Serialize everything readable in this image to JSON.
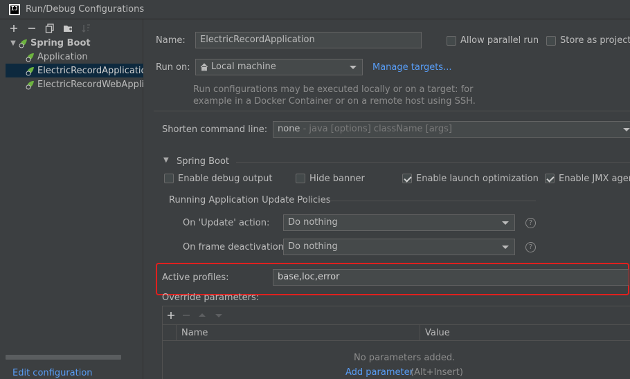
{
  "window": {
    "title": "Run/Debug Configurations",
    "logo_text": "IJ"
  },
  "sidebar": {
    "toolbar": [
      {
        "name": "add-icon",
        "glyph": "+"
      },
      {
        "name": "remove-icon",
        "glyph": "−"
      },
      {
        "name": "copy-icon",
        "glyph": "⧉"
      },
      {
        "name": "folder-icon",
        "glyph": "▣"
      },
      {
        "name": "sort-icon",
        "glyph": "⇅"
      }
    ],
    "group_label": "Spring Boot",
    "items": [
      {
        "label": "Application"
      },
      {
        "label": "ElectricRecordApplication"
      },
      {
        "label": "ElectricRecordWebApplication"
      }
    ],
    "edit_templates_link": "Edit configuration templates..."
  },
  "form": {
    "name_label": "Name:",
    "name_value": "ElectricRecordApplication",
    "allow_parallel_label": "Allow parallel run",
    "store_project_label": "Store as project file",
    "run_on_label": "Run on:",
    "run_on_value": "Local machine",
    "manage_targets": "Manage targets...",
    "run_on_hint_1": "Run configurations may be executed locally or on a target: for",
    "run_on_hint_2": "example in a Docker Container or on a remote host using SSH.",
    "shorten_label": "Shorten command line:",
    "shorten_value": "none",
    "shorten_hint": " - java [options] className [args]",
    "spring_section_label": "Spring Boot",
    "debug_output_label": "Enable debug output",
    "hide_banner_label": "Hide banner",
    "launch_opt_label": "Enable launch optimization",
    "jmx_label": "Enable JMX agent",
    "update_policies_label": "Running Application Update Policies",
    "on_update_label": "On 'Update' action:",
    "on_update_value": "Do nothing",
    "on_frame_label": "On frame deactivation:",
    "on_frame_value": "Do nothing",
    "active_profiles_label": "Active profiles:",
    "active_profiles_value": "base,loc,error",
    "override_label": "Override parameters:",
    "col_name": "Name",
    "col_value": "Value",
    "empty_text": "No parameters added.",
    "add_parameter_link": "Add parameter",
    "add_parameter_shortcut": "(Alt+Insert)"
  },
  "colors": {
    "accent": "#589df6",
    "highlight_box": "#e0201e",
    "selection": "#0d293e"
  }
}
